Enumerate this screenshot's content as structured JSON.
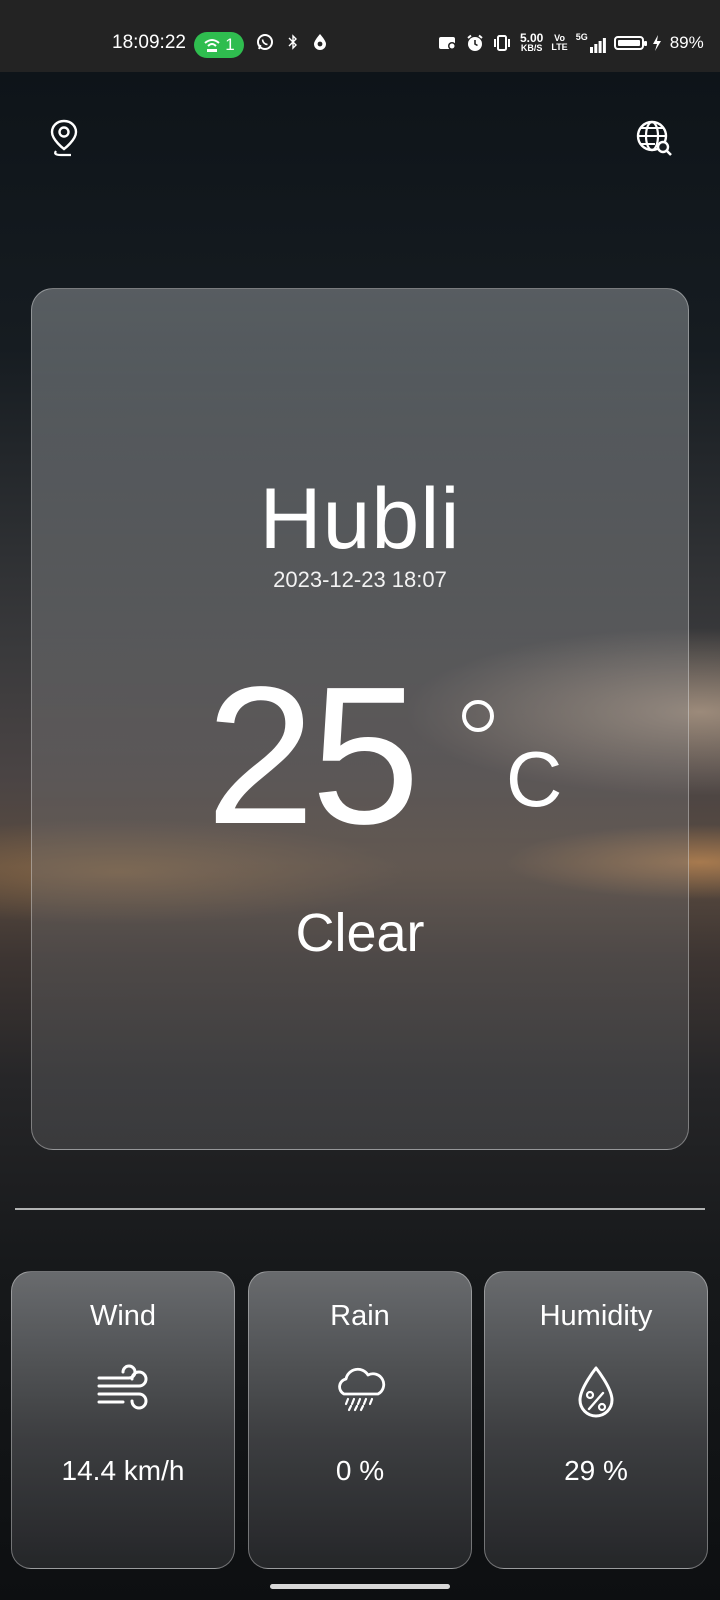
{
  "status_bar": {
    "time": "18:09:22",
    "hotspot_count": "1",
    "net_speed": "5.00",
    "net_unit": "KB/S",
    "volte_top": "Vo",
    "volte_bottom": "LTE",
    "signal_label": "5G",
    "battery": "89%"
  },
  "header": {
    "location_icon": "location-pin-icon",
    "search_icon": "globe-search-icon"
  },
  "weather": {
    "city": "Hubli",
    "datetime": "2023-12-23 18:07",
    "temperature": "25",
    "unit": "C",
    "condition": "Clear"
  },
  "stats": [
    {
      "title": "Wind",
      "icon": "wind-icon",
      "value": "14.4 km/h"
    },
    {
      "title": "Rain",
      "icon": "rain-cloud-icon",
      "value": "0 %"
    },
    {
      "title": "Humidity",
      "icon": "humidity-drop-icon",
      "value": "29 %"
    }
  ]
}
